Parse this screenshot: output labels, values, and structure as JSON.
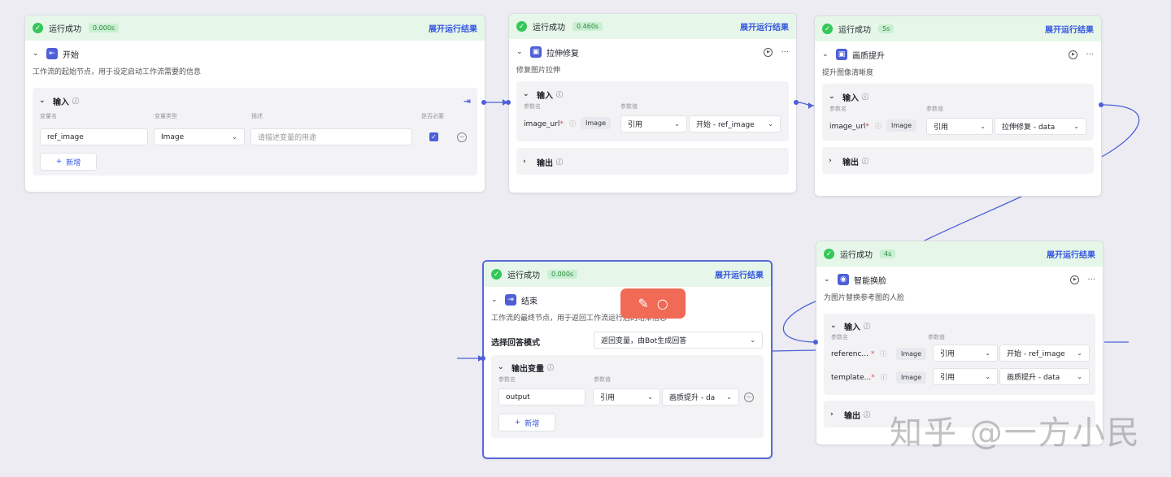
{
  "common": {
    "status": "运行成功",
    "expand_label": "展开运行结果",
    "input_label": "输入",
    "output_label": "输出",
    "param_name_label": "参数名",
    "param_value_label": "参数值",
    "image_type": "Image",
    "ref_mode": "引用",
    "add_label": "新增"
  },
  "start": {
    "time": "0.000s",
    "title": "开始",
    "desc": "工作流的起始节点，用于设定启动工作流需要的信息",
    "col_var_name": "变量名",
    "col_var_type": "变量类型",
    "col_desc": "描述",
    "col_required": "是否必要",
    "var_name": "ref_image",
    "var_type": "Image",
    "var_desc_placeholder": "请描述变量的用途"
  },
  "stretch": {
    "time": "0.460s",
    "title": "拉伸修复",
    "desc": "修复图片拉伸",
    "param": "image_url",
    "source": "开始 - ref_image"
  },
  "quality": {
    "time": "5s",
    "title": "画质提升",
    "desc": "提升图像清晰度",
    "param": "image_url",
    "source": "拉伸修复 - data"
  },
  "faceswap": {
    "time": "4s",
    "title": "智能换脸",
    "desc": "为图片替换参考图的人脸",
    "param1": "referenc...",
    "source1": "开始 - ref_image",
    "param2": "template...",
    "source2": "画质提升 - data"
  },
  "end": {
    "time": "0.000s",
    "title": "结束",
    "desc": "工作流的最终节点，用于返回工作流运行后的结果信息",
    "mode_label": "选择回答模式",
    "mode_value": "返回变量，由Bot生成回答",
    "output_vars_label": "输出变量",
    "out_param": "output",
    "out_source": "画质提升 - da"
  },
  "watermark": "知乎 @一方小民",
  "colors": {
    "accent": "#4e5fd8",
    "success_bg": "#e6f7e9",
    "link": "#3355e0"
  }
}
